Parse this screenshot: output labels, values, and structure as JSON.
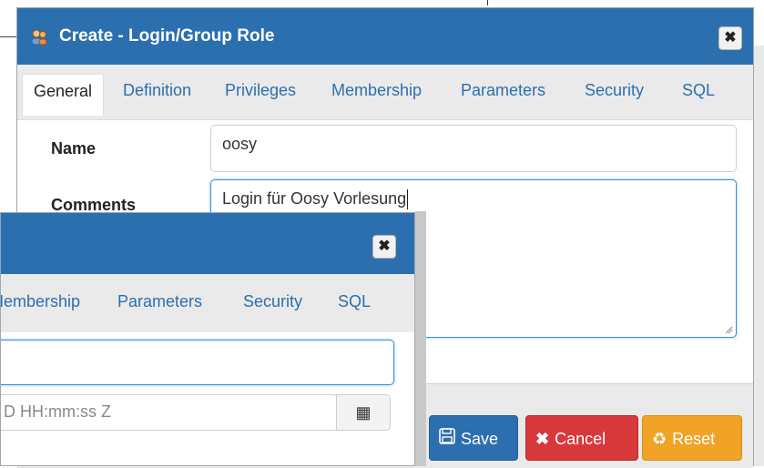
{
  "colors": {
    "primary": "#2c6fae",
    "danger": "#d9383b",
    "warning": "#f0a327"
  },
  "dialog_back": {
    "title": "Create - Login/Group Role",
    "close_label": "✖",
    "tabs": [
      "General",
      "Definition",
      "Privileges",
      "Membership",
      "Parameters",
      "Security",
      "SQL"
    ],
    "active_tab": "General",
    "fields": {
      "name": {
        "label": "Name",
        "value": "oosy"
      },
      "comments": {
        "label": "Comments",
        "value": "Login für Oosy Vorlesung"
      }
    },
    "buttons": {
      "save": "Save",
      "cancel": "Cancel",
      "reset": "Reset"
    },
    "icons": {
      "title": "group-role-icon",
      "save": "floppy-disk-icon",
      "cancel": "x-icon",
      "reset": "recycle-icon"
    }
  },
  "dialog_front": {
    "close_label": "✖",
    "tabs": [
      "Membership",
      "Parameters",
      "Security",
      "SQL"
    ],
    "date_placeholder": "D HH:mm:ss Z",
    "icons": {
      "calendar": "calendar-icon"
    }
  }
}
